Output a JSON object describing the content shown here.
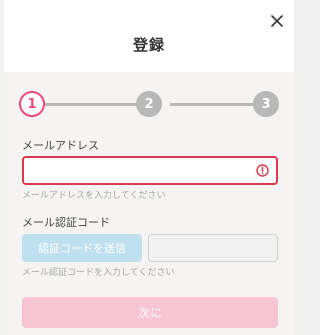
{
  "dialog": {
    "title": "登録"
  },
  "stepper": {
    "current_step": 1,
    "steps": [
      {
        "label": "1",
        "state": "active"
      },
      {
        "label": "2",
        "state": "inactive"
      },
      {
        "label": "3",
        "state": "inactive"
      }
    ]
  },
  "email": {
    "label": "メールアドレス",
    "value": "",
    "hint": "メールアドレスを入力してください",
    "state": "error"
  },
  "verification": {
    "label": "メール認証コード",
    "send_button_label": "認証コードを送信",
    "code_value": "",
    "hint": "メール認証コードを入力してください"
  },
  "footer": {
    "next_button_label": "次に"
  },
  "icons": {
    "close": "close-icon",
    "error": "error-icon"
  },
  "colors": {
    "accent": "#e94b76",
    "error": "#d7394f",
    "step_inactive": "#b8b8b8",
    "send_button_disabled": "#bfe1ef",
    "next_button_disabled": "#f7c5d3"
  }
}
